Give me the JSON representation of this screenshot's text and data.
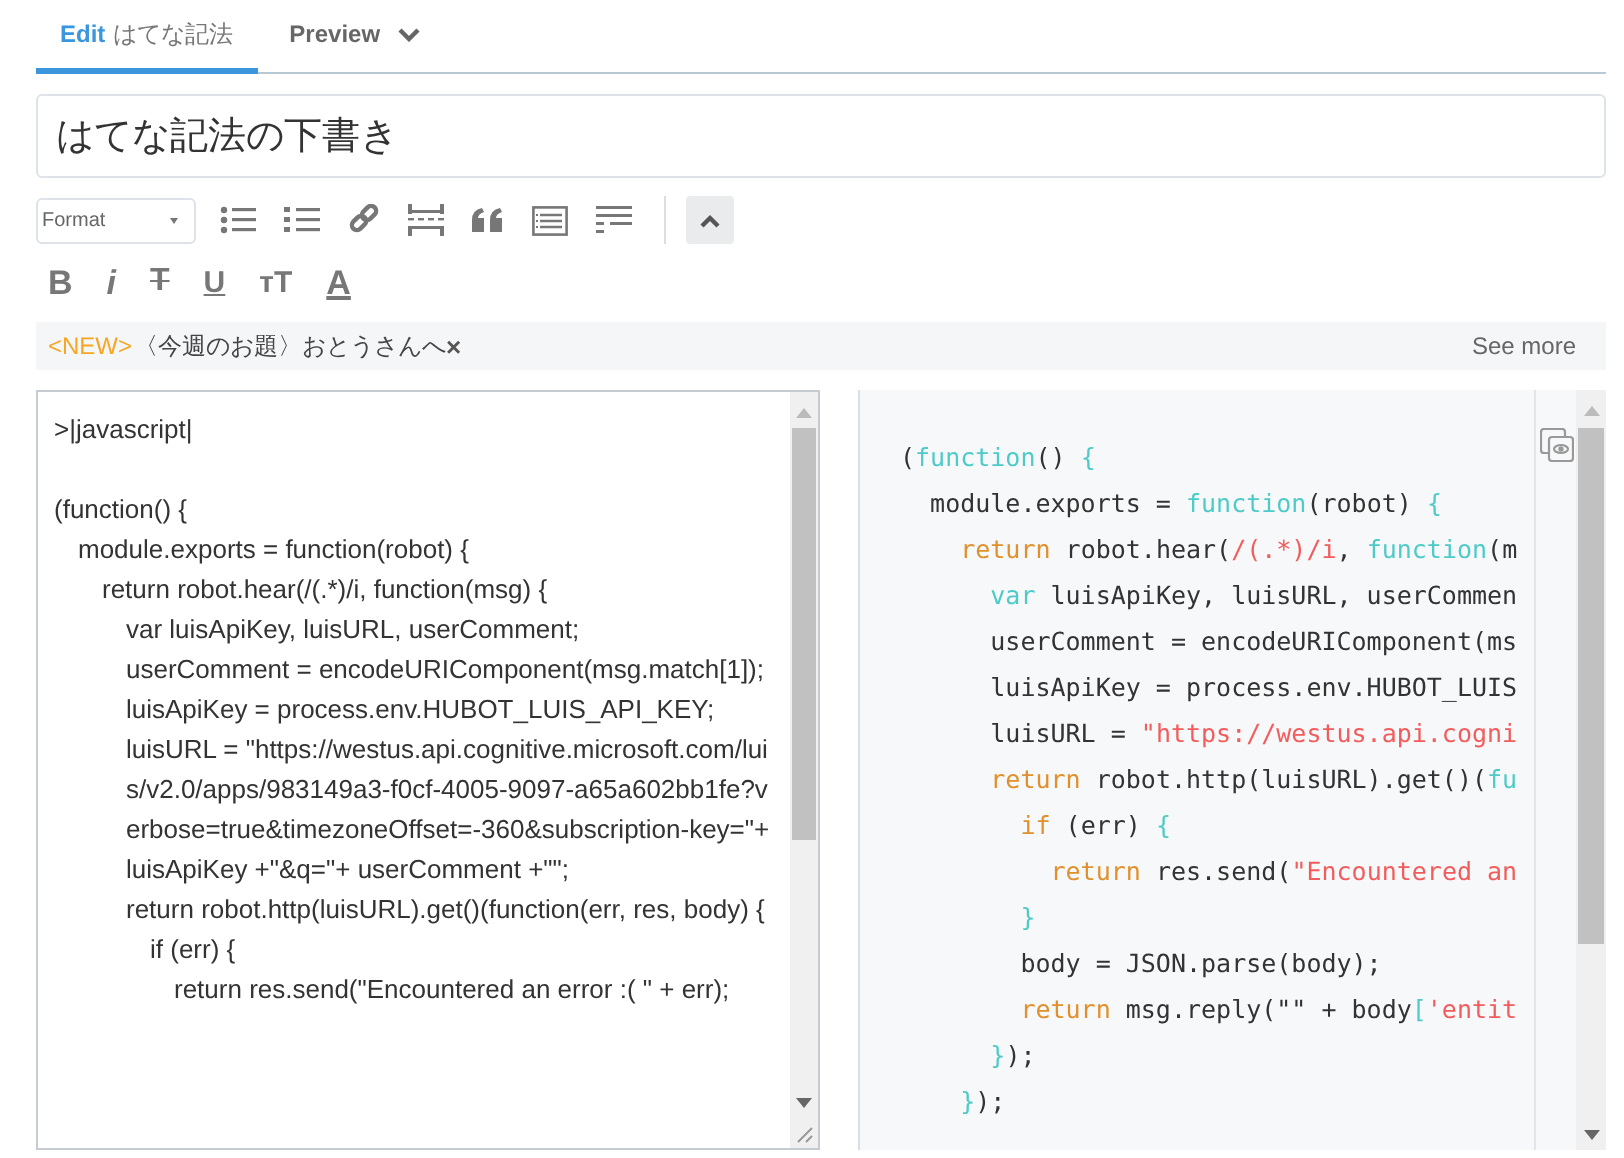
{
  "tabs": [
    {
      "label": "Edit",
      "sublabel": "はてな記法",
      "selected": true
    },
    {
      "label": "Preview",
      "selected": false
    }
  ],
  "title_field": {
    "value": "はてな記法の下書き"
  },
  "toolbar": {
    "format_select": "Format",
    "format_buttons": [
      {
        "kind": "bold",
        "label": "B"
      },
      {
        "kind": "italic",
        "label": "i"
      },
      {
        "kind": "strike",
        "label": "T"
      },
      {
        "kind": "underline",
        "label": "U"
      },
      {
        "kind": "size",
        "label": "тT"
      },
      {
        "kind": "color",
        "label": "A"
      }
    ]
  },
  "banner": {
    "badge": "<NEW>",
    "text": "〈今週のお題〉おとうさんへ",
    "close": "×",
    "link": "See more"
  },
  "editor": {
    "lines": [
      ">|javascript|",
      "(function() {",
      "  module.exports = function(robot) {",
      "    return robot.hear(/(.*)/i, function(msg) {",
      "      var luisApiKey, luisURL, userComment;",
      "      userComment = encodeURIComponent(msg.match[1]);",
      "      luisApiKey = process.env.HUBOT_LUIS_API_KEY;",
      "      luisURL = \"https://westus.api.cognitive.microsoft.com/luis/v2.0/apps/983149a3-f0cf-4005-9097-a65a602bb1fe?verbose=true&timezoneOffset=-360&subscription-key=\"+ luisApiKey +\"&q=\"+ userComment +\"\";",
      "      return robot.http(luisURL).get()(function(err, res, body) {",
      "        if (err) {",
      "          return res.send(\"Encountered an error :( \" + err);"
    ]
  },
  "preview": {
    "lines": [
      [
        {
          "kind": "plain",
          "text": "("
        },
        {
          "kind": "func",
          "text": "function"
        },
        {
          "kind": "plain",
          "text": "() "
        },
        {
          "kind": "func",
          "text": "{"
        }
      ],
      [
        {
          "kind": "plain",
          "text": "  module.exports = "
        },
        {
          "kind": "func",
          "text": "function"
        },
        {
          "kind": "plain",
          "text": "(robot) "
        },
        {
          "kind": "func",
          "text": "{"
        }
      ],
      [
        {
          "kind": "keyword",
          "text": "    return"
        },
        {
          "kind": "plain",
          "text": " robot.hear("
        },
        {
          "kind": "string",
          "text": "/(.*)/i"
        },
        {
          "kind": "plain",
          "text": ", "
        },
        {
          "kind": "func",
          "text": "function"
        },
        {
          "kind": "plain",
          "text": "(m"
        }
      ],
      [
        {
          "kind": "func",
          "text": "      var"
        },
        {
          "kind": "plain",
          "text": " luisApiKey, luisURL, userCommen"
        }
      ],
      [
        {
          "kind": "plain",
          "text": "      userComment = encodeURIComponent(ms"
        }
      ],
      [
        {
          "kind": "plain",
          "text": "      luisApiKey = process.env.HUBOT_LUIS"
        }
      ],
      [
        {
          "kind": "plain",
          "text": "      luisURL = "
        },
        {
          "kind": "string",
          "text": "\"https://westus.api.cogni"
        }
      ],
      [
        {
          "kind": "keyword",
          "text": "      return"
        },
        {
          "kind": "plain",
          "text": " robot.http(luisURL).get()("
        },
        {
          "kind": "func",
          "text": "fu"
        }
      ],
      [
        {
          "kind": "keyword",
          "text": "        if"
        },
        {
          "kind": "plain",
          "text": " (err) "
        },
        {
          "kind": "func",
          "text": "{"
        }
      ],
      [
        {
          "kind": "keyword",
          "text": "          return"
        },
        {
          "kind": "plain",
          "text": " res.send("
        },
        {
          "kind": "string",
          "text": "\"Encountered an"
        }
      ],
      [
        {
          "kind": "func",
          "text": "        }"
        }
      ],
      [
        {
          "kind": "plain",
          "text": "        body = JSON.parse(body);"
        }
      ],
      [
        {
          "kind": "keyword",
          "text": "        return"
        },
        {
          "kind": "plain",
          "text": " msg.reply(\"\" + body"
        },
        {
          "kind": "func",
          "text": "["
        },
        {
          "kind": "string",
          "text": "'entit"
        }
      ],
      [
        {
          "kind": "func",
          "text": "      }"
        },
        {
          "kind": "plain",
          "text": ");"
        }
      ],
      [
        {
          "kind": "func",
          "text": "    }"
        },
        {
          "kind": "plain",
          "text": ");"
        }
      ]
    ]
  }
}
